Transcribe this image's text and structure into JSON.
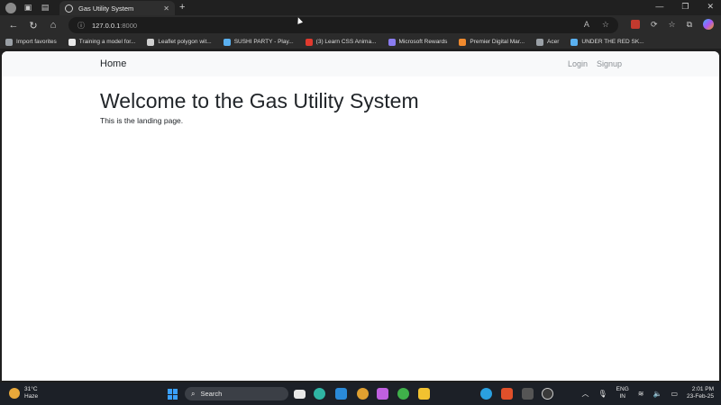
{
  "browser": {
    "tab_title": "Gas Utility System",
    "tab_close": "✕",
    "new_tab": "+",
    "url_host": "127.0.0.1",
    "url_port": ":8000",
    "window_controls": [
      "—",
      "❐",
      "✕"
    ],
    "nav_icons": [
      "back-icon",
      "refresh-icon",
      "home-icon"
    ]
  },
  "bookmarks": [
    {
      "label": "Import favorites",
      "icon_color": "#9aa0a6"
    },
    {
      "label": "Training a model for...",
      "icon_color": "#e8e8e8"
    },
    {
      "label": "Leaflet polygon wit...",
      "icon_color": "#d0d0d0"
    },
    {
      "label": "SUSHI PARTY - Play...",
      "icon_color": "#5ab0f0"
    },
    {
      "label": "(3) Learn CSS Anima...",
      "icon_color": "#e03a2e"
    },
    {
      "label": "Microsoft Rewards",
      "icon_color": "#8a7cf0"
    },
    {
      "label": "Premier Digital Mar...",
      "icon_color": "#f08a2e"
    },
    {
      "label": "Acer",
      "icon_color": "#9aa0a6"
    },
    {
      "label": "UNDER THE RED SK...",
      "icon_color": "#5ab0f0"
    }
  ],
  "page": {
    "brand": "Home",
    "nav_links": [
      "Login",
      "Signup"
    ],
    "heading": "Welcome to the Gas Utility System",
    "subtext": "This is the landing page."
  },
  "taskbar": {
    "temperature": "31°C",
    "weather": "Haze",
    "search_placeholder": "Search",
    "lang_top": "ENG",
    "lang_bottom": "IN",
    "time": "2:01 PM",
    "date": "23-Feb-25"
  },
  "colors": {
    "accent": "#3aa0ff",
    "navbar_bg": "#f8f9fa",
    "text": "#212529",
    "muted": "#8a8f94"
  }
}
